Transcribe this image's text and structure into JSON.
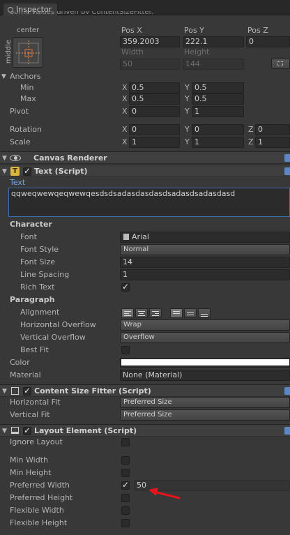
{
  "tab": {
    "label": "Inspector"
  },
  "notice": "Some values driven by ContentSizeFitter.",
  "anchor_preset": {
    "top": "center",
    "side": "middle"
  },
  "rect_transform": {
    "headers": {
      "pos_x": "Pos X",
      "pos_y": "Pos Y",
      "pos_z": "Pos Z",
      "width": "Width",
      "height": "Height"
    },
    "pos_x": "359.2003",
    "pos_y": "222.1",
    "pos_z": "0",
    "width": "50",
    "height": "144",
    "anchors_label": "Anchors",
    "min_label": "Min",
    "min_x": "0.5",
    "min_y": "0.5",
    "max_label": "Max",
    "max_x": "0.5",
    "max_y": "0.5",
    "pivot_label": "Pivot",
    "pivot_x": "0",
    "pivot_y": "1"
  },
  "transform": {
    "rotation_label": "Rotation",
    "rot_x": "0",
    "rot_y": "0",
    "rot_z": "0",
    "scale_label": "Scale",
    "scale_x": "1",
    "scale_y": "1",
    "scale_z": "1"
  },
  "axis": {
    "x": "X",
    "y": "Y",
    "z": "Z"
  },
  "canvas_renderer": {
    "title": "Canvas Renderer"
  },
  "text_script": {
    "title": "Text (Script)",
    "text_label": "Text",
    "text_value": "qqweqwewqeqwewqesdsdsadasdasdasdsadasdsadasdasd",
    "character_label": "Character",
    "font_label": "Font",
    "font_value": "Arial",
    "font_style_label": "Font Style",
    "font_style_value": "Normal",
    "font_size_label": "Font Size",
    "font_size_value": "14",
    "line_spacing_label": "Line Spacing",
    "line_spacing_value": "1",
    "rich_text_label": "Rich Text",
    "rich_text_checked": true,
    "paragraph_label": "Paragraph",
    "alignment_label": "Alignment",
    "horizontal_overflow_label": "Horizontal Overflow",
    "horizontal_overflow_value": "Wrap",
    "vertical_overflow_label": "Vertical Overflow",
    "vertical_overflow_value": "Overflow",
    "best_fit_label": "Best Fit",
    "best_fit_checked": false,
    "color_label": "Color",
    "color_value": "#ffffff",
    "material_label": "Material",
    "material_value": "None (Material)"
  },
  "content_size_fitter": {
    "title": "Content Size Fitter (Script)",
    "horizontal_fit_label": "Horizontal Fit",
    "horizontal_fit_value": "Preferred Size",
    "vertical_fit_label": "Vertical Fit",
    "vertical_fit_value": "Preferred Size"
  },
  "layout_element": {
    "title": "Layout Element (Script)",
    "ignore_layout_label": "Ignore Layout",
    "min_width_label": "Min Width",
    "min_height_label": "Min Height",
    "preferred_width_label": "Preferred Width",
    "preferred_width_value": "50",
    "preferred_width_checked": true,
    "preferred_height_label": "Preferred Height",
    "flexible_width_label": "Flexible Width",
    "flexible_height_label": "Flexible Height"
  },
  "colors": {
    "accent": "#5b87c6",
    "annotation_arrow": "#e8141c"
  }
}
